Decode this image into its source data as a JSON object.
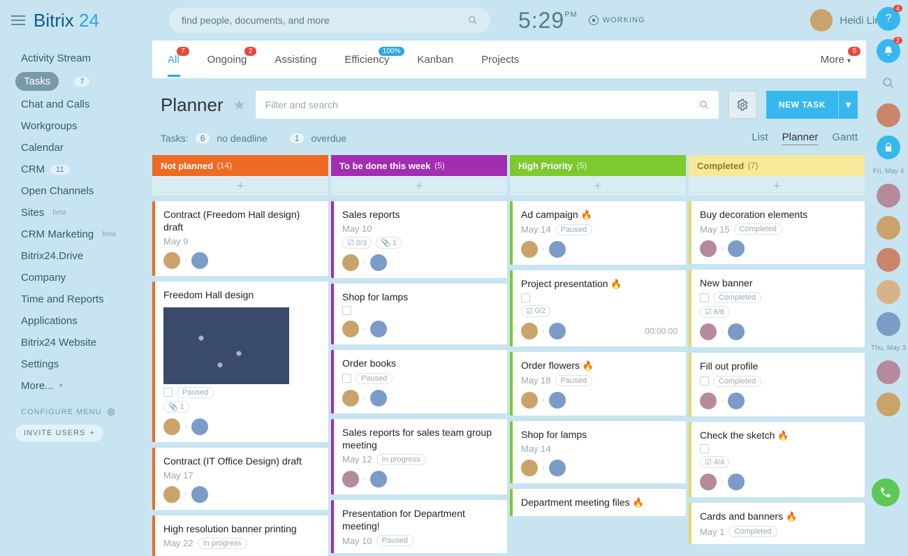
{
  "logo": {
    "a": "Bitrix",
    "b": "24"
  },
  "search_placeholder": "find people, documents, and more",
  "clock": {
    "time": "5:29",
    "ampm": "PM",
    "status": "WORKING"
  },
  "user": {
    "name": "Heidi Ling"
  },
  "sidebar": {
    "items": [
      {
        "label": "Activity Stream"
      },
      {
        "label": "Tasks",
        "count": "7",
        "active": true
      },
      {
        "label": "Chat and Calls"
      },
      {
        "label": "Workgroups"
      },
      {
        "label": "Calendar"
      },
      {
        "label": "CRM",
        "count": "11"
      },
      {
        "label": "Open Channels"
      },
      {
        "label": "Sites",
        "beta": "beta"
      },
      {
        "label": "CRM Marketing",
        "beta": "beta"
      },
      {
        "label": "Bitrix24.Drive"
      },
      {
        "label": "Company"
      },
      {
        "label": "Time and Reports"
      },
      {
        "label": "Applications"
      },
      {
        "label": "Bitrix24 Website"
      },
      {
        "label": "Settings"
      },
      {
        "label": "More..."
      }
    ],
    "configure": "CONFIGURE MENU",
    "invite": "INVITE USERS"
  },
  "tabs": {
    "all": {
      "label": "All",
      "badge": "7"
    },
    "ongoing": {
      "label": "Ongoing",
      "badge": "2"
    },
    "assisting": {
      "label": "Assisting"
    },
    "efficiency": {
      "label": "Efficiency",
      "badge": "100%"
    },
    "kanban": {
      "label": "Kanban"
    },
    "projects": {
      "label": "Projects"
    },
    "more": {
      "label": "More",
      "badge": "5"
    }
  },
  "page_title": "Planner",
  "filter_placeholder": "Filter and search",
  "new_task_label": "NEW TASK",
  "summary": {
    "prefix": "Tasks:",
    "no_deadline_count": "6",
    "no_deadline_label": "no deadline",
    "overdue_count": "1",
    "overdue_label": "overdue"
  },
  "views": {
    "list": "List",
    "planner": "Planner",
    "gantt": "Gantt"
  },
  "columns": {
    "not_planned": {
      "title": "Not planned",
      "count": "(14)"
    },
    "this_week": {
      "title": "To be done this week",
      "count": "(5)"
    },
    "high_priority": {
      "title": "High Priority",
      "count": "(5)"
    },
    "completed": {
      "title": "Completed",
      "count": "(7)"
    }
  },
  "cards": {
    "c1": {
      "title": "Contract (Freedom Hall design) draft",
      "date": "May 9"
    },
    "c2": {
      "title": "Freedom Hall design",
      "status": "Paused",
      "attach": "1"
    },
    "c3": {
      "title": "Contract (IT Office Design) draft",
      "date": "May 17"
    },
    "c4": {
      "title": "High resolution banner printing",
      "date": "May 22",
      "status": "In progress"
    },
    "c5": {
      "title": "Sales reports",
      "date": "May 10",
      "checklist": "0/3",
      "attach": "1"
    },
    "c6": {
      "title": "Shop for lamps"
    },
    "c7": {
      "title": "Order books",
      "status": "Paused"
    },
    "c8": {
      "title": "Sales reports for sales team group meeting",
      "date": "May 12",
      "status": "In progress"
    },
    "c9": {
      "title": "Presentation for Department meeting!",
      "date": "May 10",
      "status": "Paused"
    },
    "c10": {
      "title": "Ad campaign",
      "date": "May 14",
      "status": "Paused"
    },
    "c11": {
      "title": "Project presentation",
      "checklist": "0/2",
      "timer": "00:00:00"
    },
    "c12": {
      "title": "Order flowers",
      "date": "May 18",
      "status": "Paused"
    },
    "c13": {
      "title": "Shop for lamps",
      "date": "May 14"
    },
    "c14": {
      "title": "Department meeting files"
    },
    "c15": {
      "title": "Buy decoration elements",
      "date": "May 15",
      "status": "Completed"
    },
    "c16": {
      "title": "New banner",
      "status": "Completed",
      "checklist": "6/6"
    },
    "c17": {
      "title": "Fill out profile",
      "status": "Completed"
    },
    "c18": {
      "title": "Check the sketch",
      "checklist": "4/4"
    },
    "c19": {
      "title": "Cards and banners",
      "date": "May 1",
      "status": "Completed"
    }
  },
  "rail": {
    "help_badge": "4",
    "bell_badge": "2",
    "date1": "Fri, May 4",
    "date2": "Thu, May 3"
  }
}
